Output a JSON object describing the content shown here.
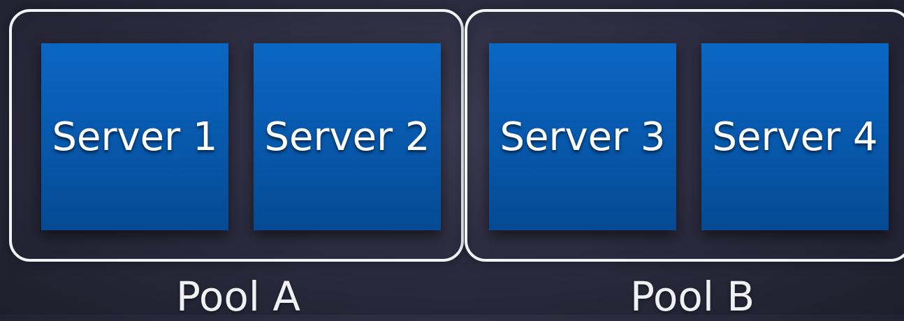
{
  "pools": [
    {
      "label": "Pool A",
      "servers": [
        "Server 1",
        "Server 2"
      ]
    },
    {
      "label": "Pool B",
      "servers": [
        "Server 3",
        "Server 4"
      ]
    }
  ],
  "colors": {
    "server_fill": "#0b67c4",
    "pool_border": "#f3f3f6",
    "background": "#2b2a3d",
    "text": "#ffffff"
  }
}
